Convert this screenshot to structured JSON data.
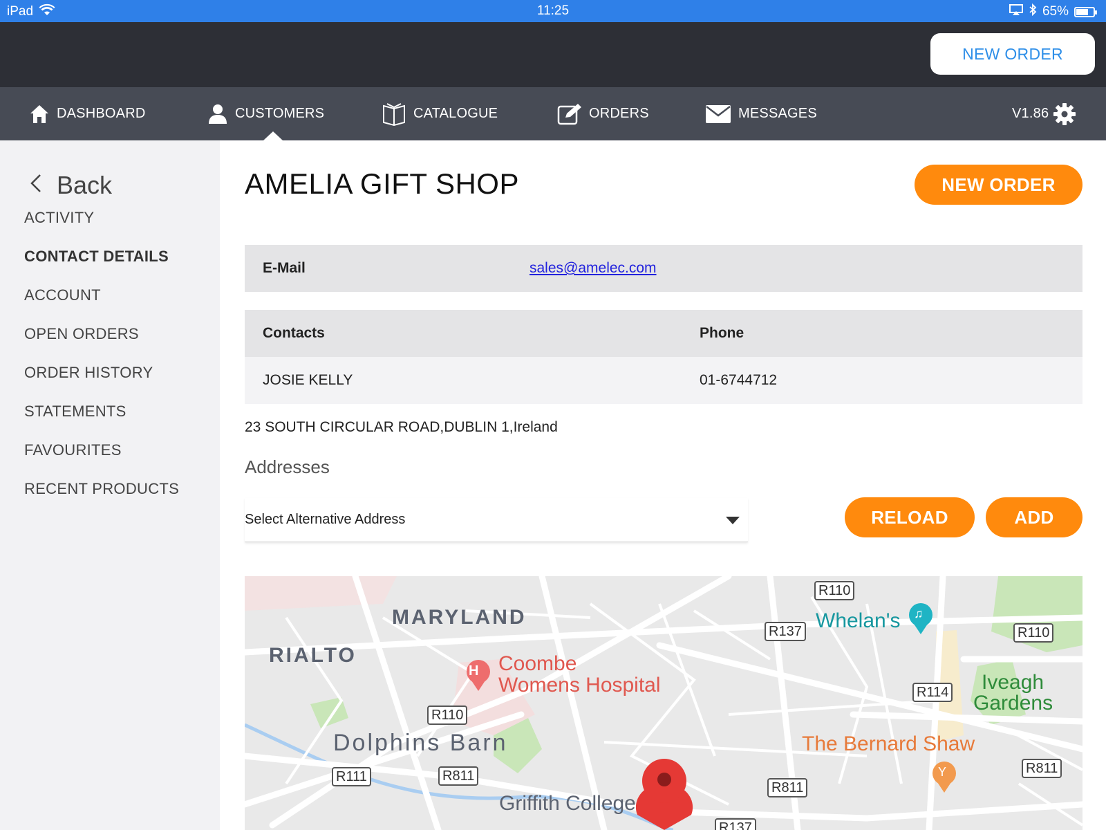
{
  "status_bar": {
    "device": "iPad",
    "time": "11:25",
    "battery": "65%",
    "battery_level": 0.65
  },
  "header": {
    "new_order_label": "NEW ORDER"
  },
  "nav": {
    "items": [
      {
        "label": "DASHBOARD",
        "icon": "home-icon"
      },
      {
        "label": "CUSTOMERS",
        "icon": "user-icon"
      },
      {
        "label": "CATALOGUE",
        "icon": "book-icon"
      },
      {
        "label": "ORDERS",
        "icon": "edit-icon"
      },
      {
        "label": "MESSAGES",
        "icon": "envelope-icon"
      }
    ],
    "active": "CUSTOMERS",
    "version": "V1.86"
  },
  "sidebar": {
    "back_label": "Back",
    "items": [
      {
        "label": "ACTIVITY"
      },
      {
        "label": "CONTACT DETAILS"
      },
      {
        "label": "ACCOUNT"
      },
      {
        "label": "OPEN ORDERS"
      },
      {
        "label": "ORDER HISTORY"
      },
      {
        "label": "STATEMENTS"
      },
      {
        "label": "FAVOURITES"
      },
      {
        "label": "RECENT PRODUCTS"
      }
    ],
    "active": "CONTACT DETAILS"
  },
  "main": {
    "title": "AMELIA GIFT SHOP",
    "new_order_label": "NEW ORDER",
    "email_label": "E-Mail",
    "email_value": "sales@amelec.com",
    "contacts_table": {
      "headers": [
        "Contacts",
        "Phone"
      ],
      "rows": [
        [
          "JOSIE KELLY",
          "01-6744712"
        ]
      ]
    },
    "address": "23 SOUTH CIRCULAR ROAD,DUBLIN 1,Ireland",
    "addresses_label": "Addresses",
    "select_placeholder": "Select Alternative Address",
    "reload_label": "RELOAD",
    "add_label": "ADD"
  },
  "map": {
    "areas": [
      "MARYLAND",
      "RIALTO",
      "Dolphins Barn"
    ],
    "places": [
      "Coombe",
      "Womens Hospital",
      "Whelan's",
      "Iveagh",
      "Gardens",
      "The Bernard Shaw",
      "Griffith College"
    ],
    "roads": [
      "R110",
      "R137",
      "R110",
      "R114",
      "R110",
      "R111",
      "R811",
      "R811",
      "R811",
      "R137"
    ]
  },
  "colors": {
    "accent_orange": "#ff8a0d",
    "status_blue": "#2f80e8",
    "header_dark": "#2d2f36",
    "nav_grey": "#474b55"
  }
}
